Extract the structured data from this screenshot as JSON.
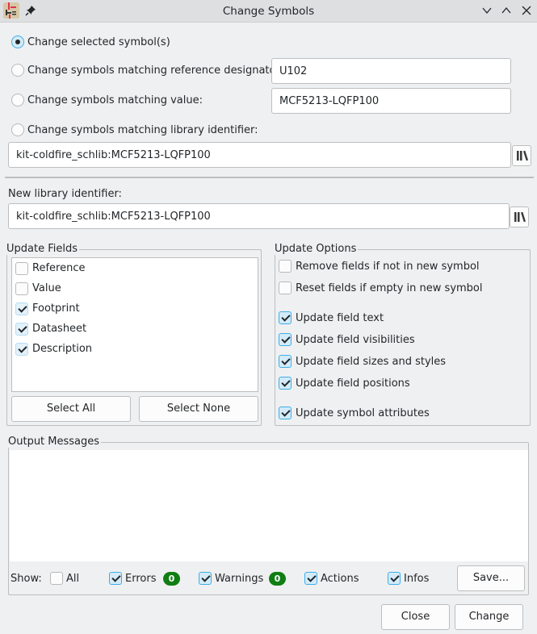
{
  "window": {
    "title": "Change Symbols",
    "controls": [
      "minimize",
      "maximize",
      "close"
    ]
  },
  "scope": {
    "options": [
      {
        "label": "Change selected symbol(s)",
        "selected": true
      },
      {
        "label": "Change symbols matching reference designator:",
        "selected": false,
        "value": "U102"
      },
      {
        "label": "Change symbols matching value:",
        "selected": false,
        "value": "MCF5213-LQFP100"
      },
      {
        "label": "Change symbols matching library identifier:",
        "selected": false,
        "value": "kit-coldfire_schlib:MCF5213-LQFP100"
      }
    ]
  },
  "new_library": {
    "label": "New library identifier:",
    "value": "kit-coldfire_schlib:MCF5213-LQFP100"
  },
  "update_fields": {
    "title": "Update Fields",
    "items": [
      {
        "label": "Reference",
        "checked": false
      },
      {
        "label": "Value",
        "checked": false
      },
      {
        "label": "Footprint",
        "checked": true
      },
      {
        "label": "Datasheet",
        "checked": true
      },
      {
        "label": "Description",
        "checked": true
      }
    ],
    "select_all_label": "Select All",
    "select_none_label": "Select None"
  },
  "update_options": {
    "title": "Update Options",
    "items": [
      {
        "label": "Remove fields if not in new symbol",
        "checked": false
      },
      {
        "label": "Reset fields if empty in new symbol",
        "checked": false
      },
      {
        "label": "Update field text",
        "checked": true
      },
      {
        "label": "Update field visibilities",
        "checked": true
      },
      {
        "label": "Update field sizes and styles",
        "checked": true
      },
      {
        "label": "Update field positions",
        "checked": true
      },
      {
        "label": "Update symbol attributes",
        "checked": true
      }
    ]
  },
  "output": {
    "title": "Output Messages",
    "show_label": "Show:",
    "filters": [
      {
        "label": "All",
        "checked": false
      },
      {
        "label": "Errors",
        "checked": true,
        "count": "0"
      },
      {
        "label": "Warnings",
        "checked": true,
        "count": "0"
      },
      {
        "label": "Actions",
        "checked": true
      },
      {
        "label": "Infos",
        "checked": true
      }
    ],
    "save_label": "Save...",
    "badge_color": "#0f7e13"
  },
  "footer": {
    "close_label": "Close",
    "change_label": "Change"
  }
}
